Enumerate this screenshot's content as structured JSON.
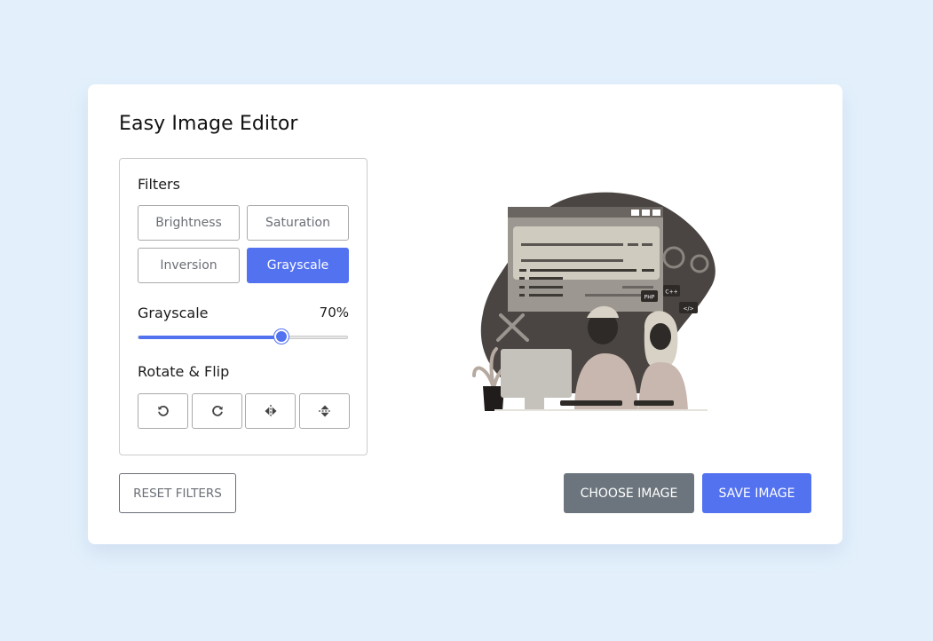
{
  "app": {
    "title": "Easy Image Editor"
  },
  "filters": {
    "heading": "Filters",
    "buttons": [
      {
        "label": "Brightness",
        "active": false
      },
      {
        "label": "Saturation",
        "active": false
      },
      {
        "label": "Inversion",
        "active": false
      },
      {
        "label": "Grayscale",
        "active": true
      }
    ]
  },
  "slider": {
    "name": "Grayscale",
    "value_text": "70%",
    "level": 0.685
  },
  "rotate": {
    "heading": "Rotate & Flip",
    "buttons": [
      {
        "icon": "rotate-left-icon"
      },
      {
        "icon": "rotate-right-icon"
      },
      {
        "icon": "flip-horizontal-icon"
      },
      {
        "icon": "flip-vertical-icon"
      }
    ]
  },
  "actions": {
    "reset_label": "RESET FILTERS",
    "choose_label": "CHOOSE IMAGE",
    "save_label": "SAVE IMAGE"
  },
  "preview": {
    "badges": [
      "PHP",
      "C++",
      "</>"
    ]
  },
  "colors": {
    "background": "#e3f0fc",
    "accent": "#5372f0",
    "secondary": "#6c757d"
  }
}
